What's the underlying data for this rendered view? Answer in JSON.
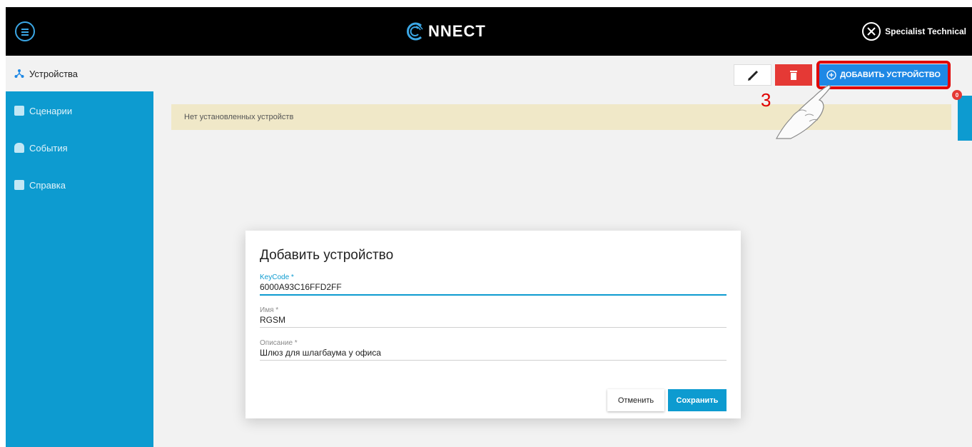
{
  "header": {
    "logo_text": "NNECT",
    "user_name": "Specialist Technical"
  },
  "sidebar": {
    "items": [
      {
        "label": "Устройства",
        "icon": "devices-icon",
        "active": true
      },
      {
        "label": "Сценарии",
        "icon": "scenarios-icon",
        "active": false
      },
      {
        "label": "События",
        "icon": "bell-icon",
        "active": false
      },
      {
        "label": "Справка",
        "icon": "help-icon",
        "active": false
      }
    ]
  },
  "toolbar": {
    "add_label": "ДОБАВИТЬ УСТРОЙСТВО"
  },
  "notice": "Нет установленных устройств",
  "annotation": {
    "step": "3"
  },
  "right_panel": {
    "badge": "0"
  },
  "modal": {
    "title": "Добавить устройство",
    "fields": [
      {
        "label": "KeyCode *",
        "value": "6000A93C16FFD2FF",
        "focused": true
      },
      {
        "label": "Имя *",
        "value": "RGSM",
        "focused": false
      },
      {
        "label": "Описание *",
        "value": "Шлюз для шлагбаума у офиса",
        "focused": false
      }
    ],
    "cancel_label": "Отменить",
    "save_label": "Сохранить"
  },
  "colors": {
    "header_bg": "#000000",
    "sidebar_bg": "#0d9bd0",
    "accent": "#1e88e5",
    "delete": "#e53935",
    "highlight": "#e00000",
    "notice_bg": "#f0e8c8"
  }
}
